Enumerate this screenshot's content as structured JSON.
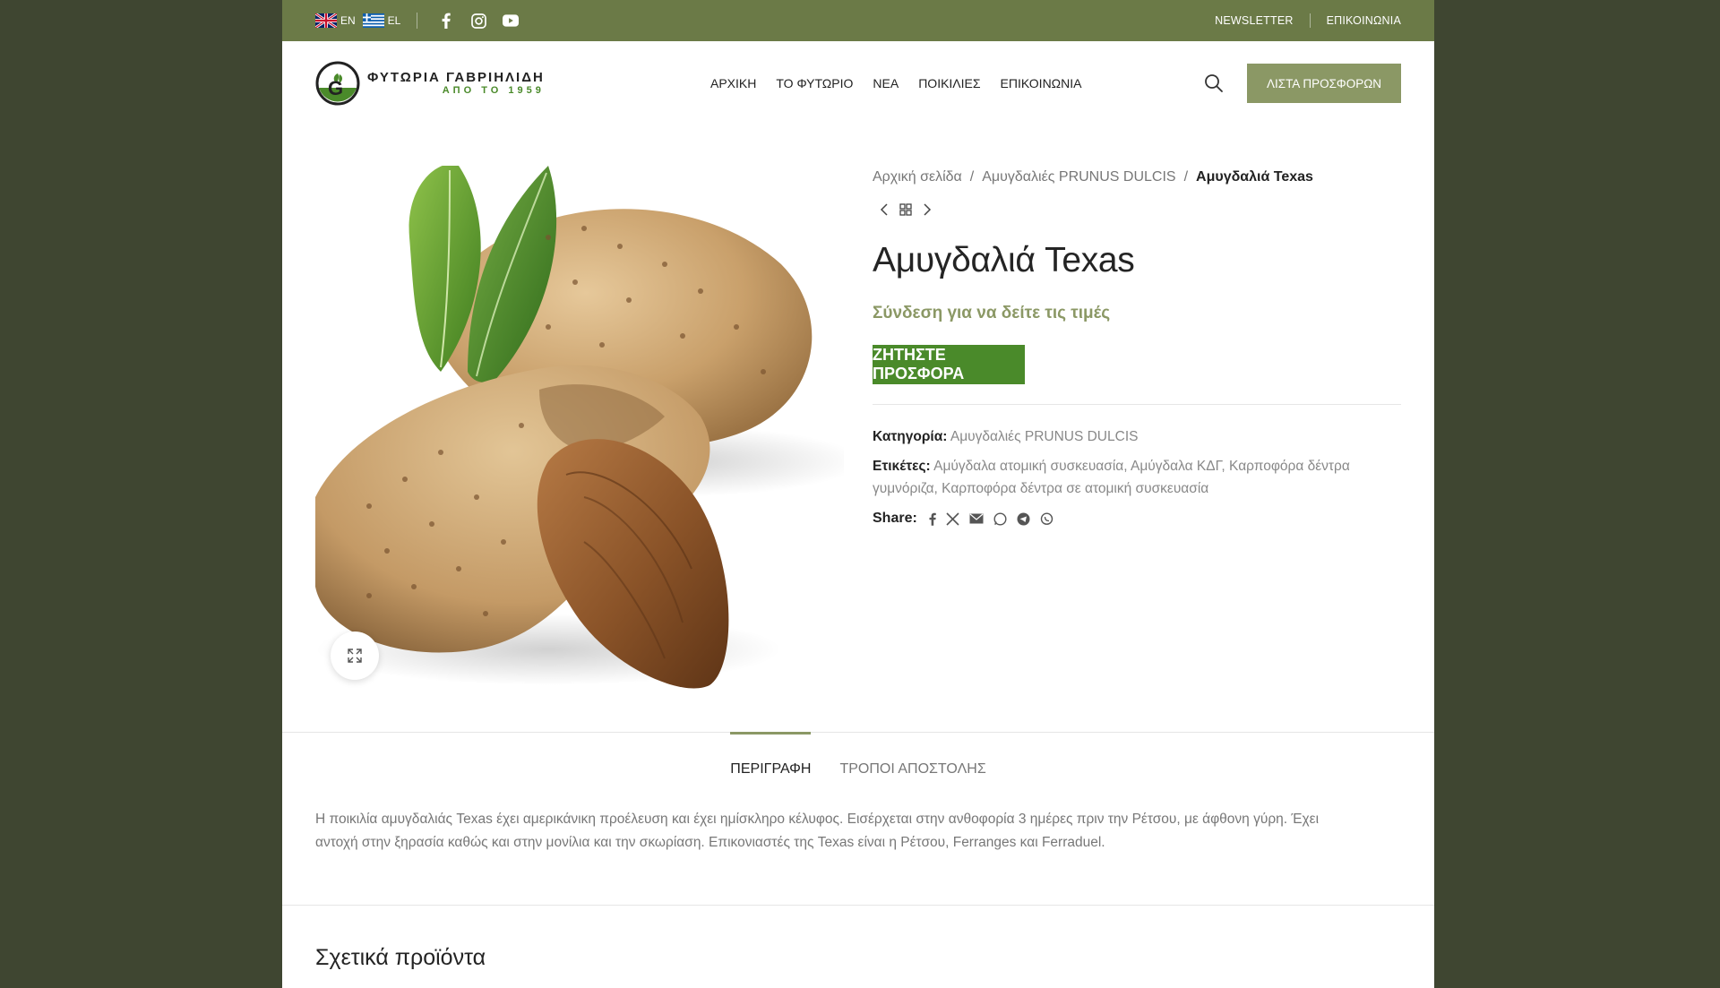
{
  "topbar": {
    "lang_en": "EN",
    "lang_el": "EL",
    "social": [
      "facebook-icon",
      "instagram-icon",
      "youtube-icon"
    ],
    "newsletter": "NEWSLETTER",
    "contact": "ΕΠΙΚΟΙΝΩΝΙΑ"
  },
  "header": {
    "logo_title": "ΦΥΤΩΡΙΑ ΓΑΒΡΙΗΛΙΔΗ",
    "logo_sub": "ΑΠΟ ΤΟ 1959",
    "nav": [
      "ΑΡΧΙΚΗ",
      "ΤΟ ΦΥΤΩΡΙΟ",
      "ΝΕΑ",
      "ΠΟΙΚΙΛΙΕΣ",
      "ΕΠΙΚΟΙΝΩΝΙΑ"
    ],
    "offer_button": "ΛΙΣΤΑ ΠΡΟΣΦΟΡΩΝ"
  },
  "breadcrumb": {
    "home": "Αρχική σελίδα",
    "category": "Αμυγδαλιές PRUNUS DULCIS",
    "current": "Αμυγδαλιά Texas"
  },
  "product": {
    "title": "Αμυγδαλιά Texas",
    "login_price": "Σύνδεση για να δείτε τις τιμές",
    "quote_button": "ΖΗΤΗΣΤΕ ΠΡΟΣΦΟΡΑ",
    "category_label": "Κατηγορία:",
    "category_value": "Αμυγδαλιές PRUNUS DULCIS",
    "tags_label": "Ετικέτες:",
    "tags": [
      "Αμύγδαλα ατομική συσκευασία",
      "Αμύγδαλα ΚΔΓ",
      "Καρποφόρα δέντρα γυμνόριζα",
      "Καρποφόρα δέντρα σε ατομική συσκευασία"
    ],
    "share_label": "Share:"
  },
  "tabs": {
    "description": "ΠΕΡΙΓΡΑΦΗ",
    "shipping": "ΤΡΟΠΟΙ ΑΠΟΣΤΟΛΗΣ"
  },
  "description_text": "Η ποικιλία αμυγδαλιάς Texas έχει αμερικάνικη προέλευση και έχει ημίσκληρο κέλυφος. Εισέρχεται στην ανθοφορία 3 ημέρες πριν την Ρέτσου, με άφθονη γύρη. Έχει αντοχή στην ξηρασία καθώς και στην μονίλια και την σκωρίαση. Επικονιαστές της Texas είναι η Ρέτσου, Ferranges και Ferraduel.",
  "related_title": "Σχετικά προϊόντα",
  "colors": {
    "olive": "#6b7a47",
    "accent": "#8b9865",
    "green": "#4a8a2a",
    "background": "#3f4631"
  }
}
